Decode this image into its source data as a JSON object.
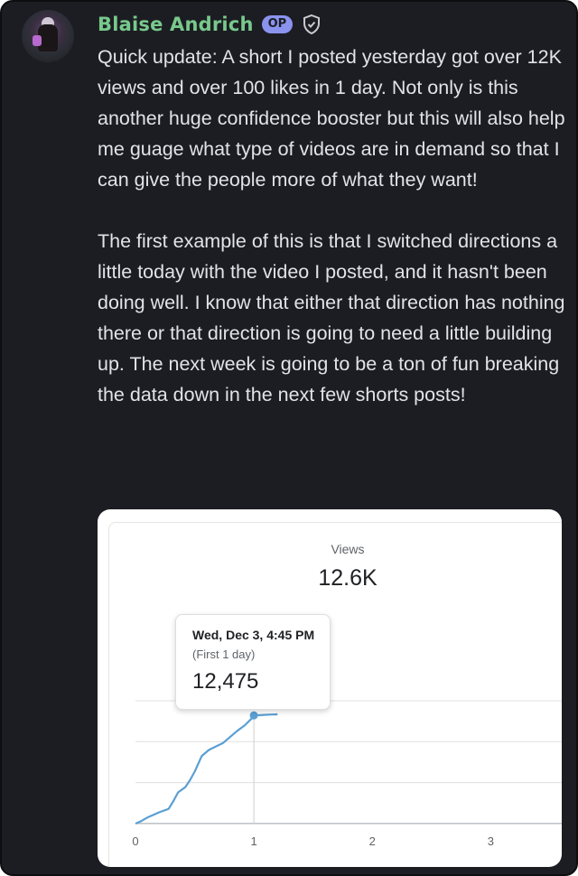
{
  "post": {
    "username": "Blaise Andrich",
    "badge": "OP",
    "paragraphs": [
      "Quick update: A short I posted yesterday got over 12K views and over 100 likes in 1 day. Not only is this another huge confidence booster but this will also help me guage what type of videos are in demand so that I can give the people more of what they want!",
      "The first example of this is that I switched directions a little today with the video I posted, and it hasn't been doing well. I know that either that direction has nothing there or that direction is going to need a little building up. The next week is going to be a ton of fun breaking the data down in the next few shorts posts!"
    ],
    "icons": {
      "badge_icon": "shield-check-icon",
      "avatar": "user-avatar"
    }
  },
  "attachment": {
    "metric_label": "Views",
    "metric_value": "12.6K",
    "tooltip": {
      "date": "Wed, Dec 3, 4:45 PM",
      "subtitle": "(First 1 day)",
      "value": "12,475"
    }
  },
  "chart_data": {
    "type": "line",
    "title": "Views",
    "xlabel": "",
    "ylabel": "",
    "x_ticks": [
      "0",
      "1",
      "2",
      "3"
    ],
    "xlim": [
      0,
      3.6
    ],
    "ylim": [
      0,
      18000
    ],
    "grid": true,
    "line_color": "#5b9fd3",
    "series": [
      {
        "x": [
          0,
          0.05,
          0.1,
          0.15,
          0.2,
          0.28,
          0.32,
          0.36,
          0.42,
          0.46,
          0.5,
          0.56,
          0.62,
          0.68,
          0.74,
          0.8,
          0.86,
          0.92,
          0.98,
          1.0,
          1.05,
          1.1,
          1.15,
          1.2
        ],
        "y": [
          0,
          300,
          700,
          1000,
          1300,
          1700,
          2600,
          3600,
          4200,
          5000,
          6000,
          7800,
          8500,
          8900,
          9300,
          10000,
          10700,
          11300,
          12100,
          12475,
          12500,
          12550,
          12580,
          12600
        ]
      }
    ],
    "highlight": {
      "x": 1.0,
      "y": 12475
    }
  }
}
